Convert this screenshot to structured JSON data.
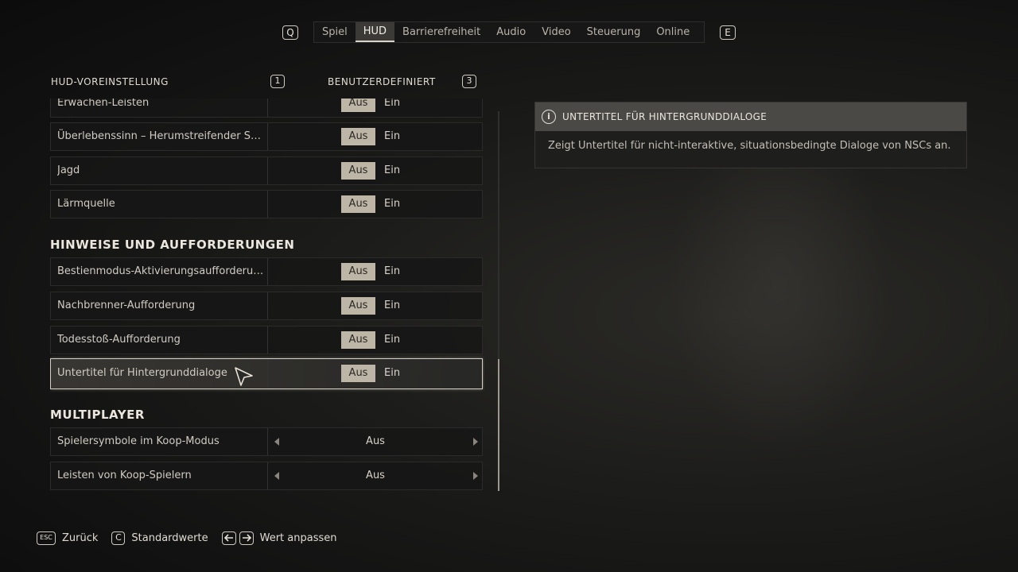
{
  "tabs": {
    "prev_key": "Q",
    "next_key": "E",
    "items": [
      "Spiel",
      "HUD",
      "Barrierefreiheit",
      "Audio",
      "Video",
      "Steuerung",
      "Online"
    ],
    "active": "HUD"
  },
  "preset": {
    "label": "HUD-VOREINSTELLUNG",
    "key_left": "1",
    "value": "BENUTZERDEFINIERT",
    "key_right": "3"
  },
  "toggle_labels": {
    "off": "Aus",
    "on": "Ein"
  },
  "rows_top": [
    {
      "label": "Erwachen-Leisten",
      "value": "Aus"
    },
    {
      "label": "Überlebenssinn – Herumstreifender Scha...",
      "value": "Aus"
    },
    {
      "label": "Jagd",
      "value": "Aus"
    },
    {
      "label": "Lärmquelle",
      "value": "Aus"
    }
  ],
  "sections": {
    "hints_title": "HINWEISE UND AUFFORDERUNGEN",
    "multiplayer_title": "MULTIPLAYER"
  },
  "rows_hints": [
    {
      "label": "Bestienmodus-Aktivierungsaufforderung",
      "value": "Aus"
    },
    {
      "label": "Nachbrenner-Aufforderung",
      "value": "Aus"
    },
    {
      "label": "Todesstoß-Aufforderung",
      "value": "Aus"
    },
    {
      "label": "Untertitel für Hintergrunddialoge",
      "value": "Aus",
      "selected": true
    }
  ],
  "rows_multiplayer": [
    {
      "label": "Spielersymbole im Koop-Modus",
      "value": "Aus"
    },
    {
      "label": "Leisten von Koop-Spielern",
      "value": "Aus"
    }
  ],
  "info": {
    "icon": "info-icon",
    "title": "UNTERTITEL FÜR HINTERGRUNDDIALOGE",
    "description": "Zeigt Untertitel für nicht-interaktive, situationsbedingte Dialoge von NSCs an."
  },
  "footer": {
    "back_key": "ESC",
    "back_label": "Zurück",
    "defaults_key": "C",
    "defaults_label": "Standardwerte",
    "adjust_label": "Wert anpassen"
  }
}
